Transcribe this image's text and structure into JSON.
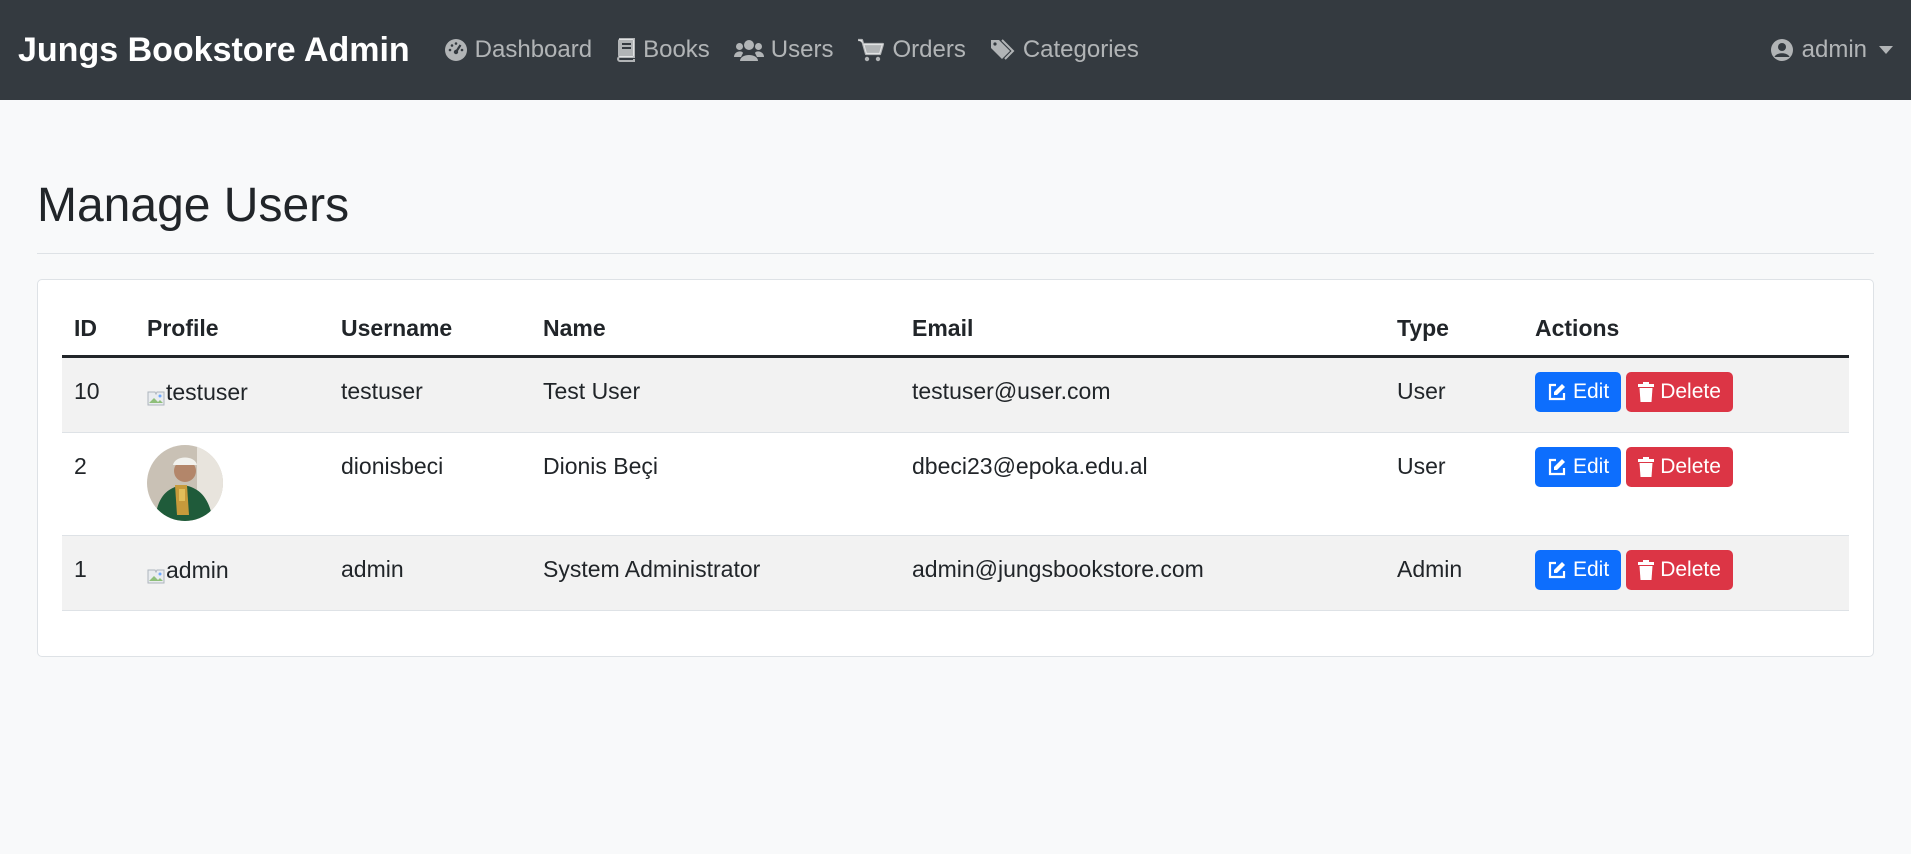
{
  "navbar": {
    "brand": "Jungs Bookstore Admin",
    "items": [
      {
        "label": "Dashboard",
        "icon": "dashboard-icon"
      },
      {
        "label": "Books",
        "icon": "book-icon"
      },
      {
        "label": "Users",
        "icon": "users-icon"
      },
      {
        "label": "Orders",
        "icon": "cart-icon"
      },
      {
        "label": "Categories",
        "icon": "tags-icon"
      }
    ],
    "user": {
      "label": "admin",
      "icon": "user-circle-icon"
    }
  },
  "page": {
    "title": "Manage Users"
  },
  "table": {
    "headers": {
      "id": "ID",
      "profile": "Profile",
      "username": "Username",
      "name": "Name",
      "email": "Email",
      "type": "Type",
      "actions": "Actions"
    },
    "rows": [
      {
        "id": "10",
        "profile_alt": "testuser",
        "username": "testuser",
        "name": "Test User",
        "email": "testuser@user.com",
        "type": "User",
        "edit": "Edit",
        "delete": "Delete"
      },
      {
        "id": "2",
        "profile_alt": "",
        "username": "dionisbeci",
        "name": "Dionis Beçi",
        "email": "dbeci23@epoka.edu.al",
        "type": "User",
        "edit": "Edit",
        "delete": "Delete"
      },
      {
        "id": "1",
        "profile_alt": "admin",
        "username": "admin",
        "name": "System Administrator",
        "email": "admin@jungsbookstore.com",
        "type": "Admin",
        "edit": "Edit",
        "delete": "Delete"
      }
    ]
  },
  "colors": {
    "navbar_bg": "#343a40",
    "edit_button": "#0d6efd",
    "delete_button": "#dc3545",
    "page_bg": "#f8f9fa"
  }
}
